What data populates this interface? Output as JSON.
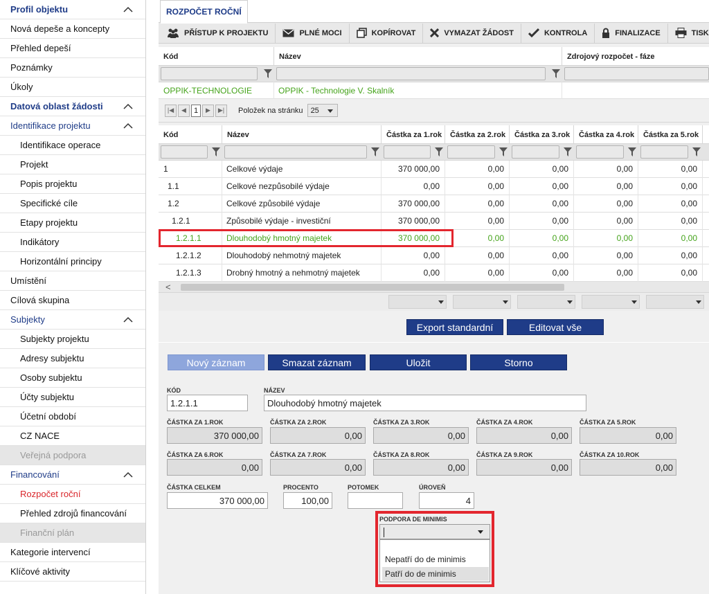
{
  "sidebar": {
    "items": [
      {
        "label": "Profil objektu",
        "kind": "head",
        "chevron": true
      },
      {
        "label": "Nová depeše a koncepty",
        "kind": "item"
      },
      {
        "label": "Přehled depeší",
        "kind": "item"
      },
      {
        "label": "Poznámky",
        "kind": "item"
      },
      {
        "label": "Úkoly",
        "kind": "item"
      },
      {
        "label": "Datová oblast žádosti",
        "kind": "head",
        "chevron": true
      },
      {
        "label": "Identifikace projektu",
        "kind": "head2",
        "chevron": true
      },
      {
        "label": "Identifikace operace",
        "kind": "sub"
      },
      {
        "label": "Projekt",
        "kind": "sub"
      },
      {
        "label": "Popis projektu",
        "kind": "sub"
      },
      {
        "label": "Specifické cíle",
        "kind": "sub"
      },
      {
        "label": "Etapy projektu",
        "kind": "sub"
      },
      {
        "label": "Indikátory",
        "kind": "sub"
      },
      {
        "label": "Horizontální principy",
        "kind": "sub"
      },
      {
        "label": "Umístění",
        "kind": "item"
      },
      {
        "label": "Cílová skupina",
        "kind": "item"
      },
      {
        "label": "Subjekty",
        "kind": "head2",
        "chevron": true
      },
      {
        "label": "Subjekty projektu",
        "kind": "sub"
      },
      {
        "label": "Adresy subjektu",
        "kind": "sub"
      },
      {
        "label": "Osoby subjektu",
        "kind": "sub"
      },
      {
        "label": "Účty subjektu",
        "kind": "sub"
      },
      {
        "label": "Účetní období",
        "kind": "sub"
      },
      {
        "label": "CZ NACE",
        "kind": "sub"
      },
      {
        "label": "Veřejná podpora",
        "kind": "sub disabled"
      },
      {
        "label": "Financování",
        "kind": "head2",
        "chevron": true
      },
      {
        "label": "Rozpočet roční",
        "kind": "sub active"
      },
      {
        "label": "Přehled zdrojů financování",
        "kind": "sub"
      },
      {
        "label": "Finanční plán",
        "kind": "sub disabled"
      },
      {
        "label": "Kategorie intervencí",
        "kind": "item"
      },
      {
        "label": "Klíčové aktivity",
        "kind": "item"
      }
    ]
  },
  "tab": {
    "label": "ROZPOČET ROČNÍ"
  },
  "toolbar": {
    "access": "PŘÍSTUP K PROJEKTU",
    "proxies": "PLNÉ MOCI",
    "copy": "KOPÍROVAT",
    "delete": "VYMAZAT ŽÁDOST",
    "check": "KONTROLA",
    "finalize": "FINALIZACE",
    "print": "TISK"
  },
  "source_table": {
    "col_code": "Kód",
    "col_name": "Název",
    "col_source": "Zdrojový rozpočet - fáze",
    "row_code": "OPPIK-TECHNOLOGIE",
    "row_name": "OPPIK - Technologie V. Skalník"
  },
  "pager": {
    "current": "1",
    "per_page_label": "Položek na stránku",
    "per_page": "25"
  },
  "budget_table": {
    "headers": [
      "Kód",
      "Název",
      "Částka za 1.rok",
      "Částka za 2.rok",
      "Částka za 3.rok",
      "Částka za 4.rok",
      "Částka za 5.rok"
    ],
    "rows": [
      {
        "code": "1",
        "name": "Celkové výdaje",
        "y1": "370 000,00",
        "y2": "0,00",
        "y3": "0,00",
        "y4": "0,00",
        "y5": "0,00"
      },
      {
        "code": "1.1",
        "name": "Celkové nezpůsobilé výdaje",
        "y1": "0,00",
        "y2": "0,00",
        "y3": "0,00",
        "y4": "0,00",
        "y5": "0,00"
      },
      {
        "code": "1.2",
        "name": "Celkové způsobilé výdaje",
        "y1": "370 000,00",
        "y2": "0,00",
        "y3": "0,00",
        "y4": "0,00",
        "y5": "0,00"
      },
      {
        "code": "1.2.1",
        "name": "Způsobilé výdaje - investiční",
        "y1": "370 000,00",
        "y2": "0,00",
        "y3": "0,00",
        "y4": "0,00",
        "y5": "0,00"
      },
      {
        "code": "1.2.1.1",
        "name": "Dlouhodobý hmotný majetek",
        "y1": "370 000,00",
        "y2": "0,00",
        "y3": "0,00",
        "y4": "0,00",
        "y5": "0,00",
        "selected": true
      },
      {
        "code": "1.2.1.2",
        "name": "Dlouhodobý nehmotný majetek",
        "y1": "0,00",
        "y2": "0,00",
        "y3": "0,00",
        "y4": "0,00",
        "y5": "0,00"
      },
      {
        "code": "1.2.1.3",
        "name": "Drobný hmotný a nehmotný majetek",
        "y1": "0,00",
        "y2": "0,00",
        "y3": "0,00",
        "y4": "0,00",
        "y5": "0,00"
      }
    ]
  },
  "buttons": {
    "export": "Export standardní",
    "edit_all": "Editovat vše",
    "new": "Nový záznam",
    "delete": "Smazat záznam",
    "save": "Uložit",
    "cancel": "Storno"
  },
  "form": {
    "code_label": "KÓD",
    "code": "1.2.1.1",
    "name_label": "NÁZEV",
    "name": "Dlouhodobý hmotný majetek",
    "y1_label": "ČÁSTKA ZA 1.ROK",
    "y1": "370 000,00",
    "y2_label": "ČÁSTKA ZA 2.ROK",
    "y2": "0,00",
    "y3_label": "ČÁSTKA ZA 3.ROK",
    "y3": "0,00",
    "y4_label": "ČÁSTKA ZA 4.ROK",
    "y4": "0,00",
    "y5_label": "ČÁSTKA ZA 5.ROK",
    "y5": "0,00",
    "y6_label": "ČÁSTKA ZA 6.ROK",
    "y6": "0,00",
    "y7_label": "ČÁSTKA ZA 7.ROK",
    "y7": "0,00",
    "y8_label": "ČÁSTKA ZA 8.ROK",
    "y8": "0,00",
    "y9_label": "ČÁSTKA ZA 9.ROK",
    "y9": "0,00",
    "y10_label": "ČÁSTKA ZA 10.ROK",
    "y10": "0,00",
    "total_label": "ČÁSTKA CELKEM",
    "total": "370 000,00",
    "percent_label": "PROCENTO",
    "percent": "100,00",
    "child_label": "POTOMEK",
    "child": "",
    "level_label": "ÚROVEŇ",
    "level": "4",
    "deminimis_label": "PODPORA DE MINIMIS",
    "deminimis_options": [
      "Nepatří do de minimis",
      "Patří do de minimis"
    ]
  },
  "colors": {
    "accent": "#1f3c88",
    "highlight": "#e3262e",
    "green": "#44a31a",
    "active_nav": "#d9262b"
  }
}
